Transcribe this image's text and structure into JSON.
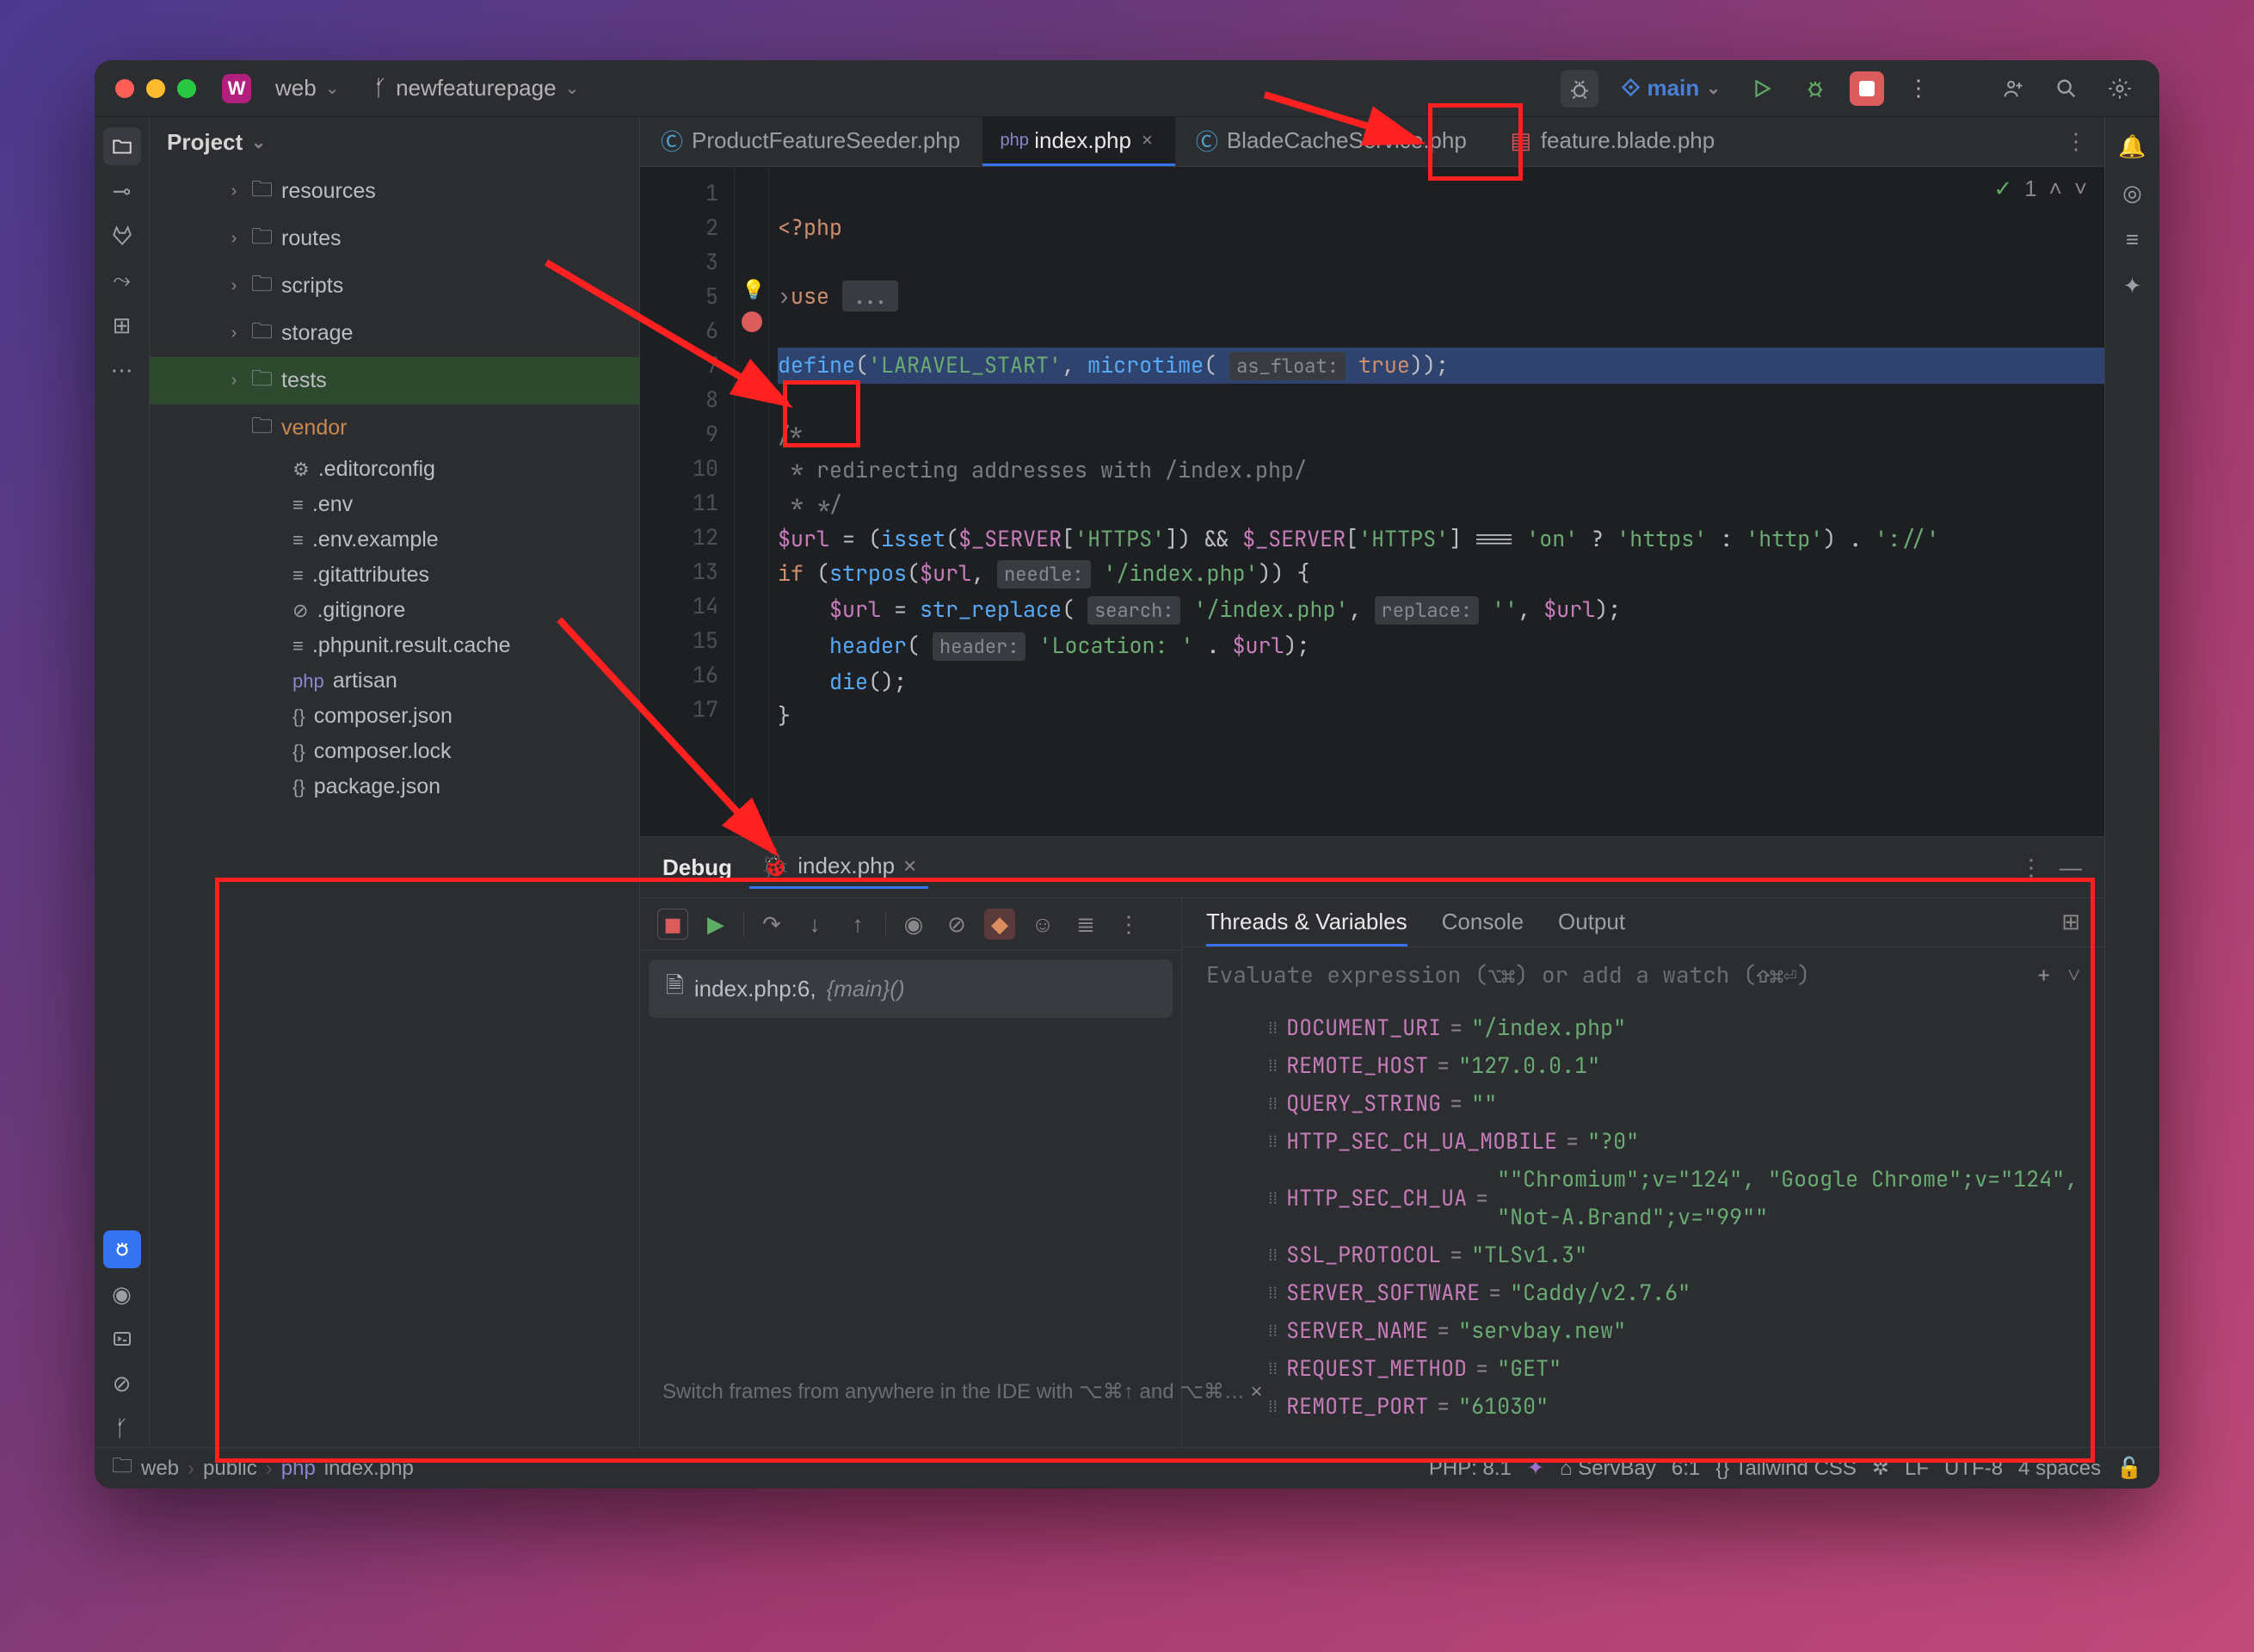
{
  "titlebar": {
    "project_badge": "W",
    "project_name": "web",
    "branch_icon": "branch",
    "branch_name": "newfeaturepage",
    "vcs_label": "main"
  },
  "toolbar_icons": [
    "debug-listen",
    "vcs",
    "main-dropdown",
    "run",
    "debug",
    "stop",
    "more",
    "add-user",
    "search",
    "settings"
  ],
  "sidebar": {
    "header": "Project",
    "tree": [
      {
        "label": "resources",
        "type": "folder",
        "depth": 1,
        "expandable": true
      },
      {
        "label": "routes",
        "type": "folder",
        "depth": 1,
        "expandable": true
      },
      {
        "label": "scripts",
        "type": "folder",
        "depth": 1,
        "expandable": true
      },
      {
        "label": "storage",
        "type": "folder",
        "depth": 1,
        "expandable": true
      },
      {
        "label": "tests",
        "type": "folder",
        "depth": 1,
        "expandable": true,
        "hl": true
      },
      {
        "label": "vendor",
        "type": "folder",
        "depth": 1,
        "expandable": false,
        "orange": true
      },
      {
        "label": ".editorconfig",
        "type": "gear",
        "depth": 2
      },
      {
        "label": ".env",
        "type": "file",
        "depth": 2
      },
      {
        "label": ".env.example",
        "type": "file",
        "depth": 2
      },
      {
        "label": ".gitattributes",
        "type": "file",
        "depth": 2
      },
      {
        "label": ".gitignore",
        "type": "ignore",
        "depth": 2
      },
      {
        "label": ".phpunit.result.cache",
        "type": "file",
        "depth": 2
      },
      {
        "label": "artisan",
        "type": "php",
        "depth": 2
      },
      {
        "label": "composer.json",
        "type": "json",
        "depth": 2
      },
      {
        "label": "composer.lock",
        "type": "json",
        "depth": 2
      },
      {
        "label": "package.json",
        "type": "json",
        "depth": 2
      }
    ]
  },
  "tabs": [
    {
      "label": "ProductFeatureSeeder.php",
      "icon": "php-cls",
      "color": "#4fa3d1"
    },
    {
      "label": "index.php",
      "icon": "php",
      "active": true
    },
    {
      "label": "BladeCacheService.php",
      "icon": "php-cls",
      "color": "#4fa3d1"
    },
    {
      "label": "feature.blade.php",
      "icon": "blade",
      "color": "#d15555"
    }
  ],
  "editor": {
    "lines": [
      "1",
      "2",
      "3",
      "5",
      "6",
      "7",
      "8",
      "9",
      "10",
      "11",
      "12",
      "13",
      "14",
      "15",
      "16",
      "17"
    ],
    "code": {
      "l1": "<?php",
      "l3_use": "use",
      "l3_fold": "...",
      "l6_define": "define",
      "l6_str": "'LARAVEL_START'",
      "l6_fn": "microtime",
      "l6_hint": "as_float:",
      "l6_true": "true",
      "l8": "/*",
      "l9": " * redirecting addresses with /index.php/",
      "l10": " * */",
      "l11_var": "$url",
      "l11_isset": "isset",
      "l11_srv": "$_SERVER",
      "l11_https": "'HTTPS'",
      "l11_on": "'on'",
      "l11_https2": "'https'",
      "l11_http": "'http'",
      "l11_sep": "'://'",
      "l12_if": "if",
      "l12_strpos": "strpos",
      "l12_hint": "needle:",
      "l12_idx": "'/index.php'",
      "l13_repl": "str_replace",
      "l13_h1": "search:",
      "l13_idx": "'/index.php'",
      "l13_h2": "replace:",
      "l13_empty": "''",
      "l14_hdr": "header",
      "l14_hint": "header:",
      "l14_loc": "'Location: '",
      "l15_die": "die"
    },
    "overlay": {
      "checks": "1"
    }
  },
  "debug": {
    "title": "Debug",
    "tab": "index.php",
    "frame": {
      "file": "index.php:6,",
      "fn": "{main}()"
    },
    "tabs2": [
      "Threads & Variables",
      "Console",
      "Output"
    ],
    "eval_placeholder": "Evaluate expression (⌥⌘) or add a watch (⇧⌘⏎)",
    "vars": [
      {
        "name": "DOCUMENT_URI",
        "val": "\"/index.php\""
      },
      {
        "name": "REMOTE_HOST",
        "val": "\"127.0.0.1\""
      },
      {
        "name": "QUERY_STRING",
        "val": "\"\""
      },
      {
        "name": "HTTP_SEC_CH_UA_MOBILE",
        "val": "\"?0\""
      },
      {
        "name": "HTTP_SEC_CH_UA",
        "val": "\"\"Chromium\";v=\"124\", \"Google Chrome\";v=\"124\", \"Not-A.Brand\";v=\"99\"\""
      },
      {
        "name": "SSL_PROTOCOL",
        "val": "\"TLSv1.3\""
      },
      {
        "name": "SERVER_SOFTWARE",
        "val": "\"Caddy/v2.7.6\""
      },
      {
        "name": "SERVER_NAME",
        "val": "\"servbay.new\""
      },
      {
        "name": "REQUEST_METHOD",
        "val": "\"GET\""
      },
      {
        "name": "REMOTE_PORT",
        "val": "\"61030\""
      }
    ],
    "tip": "Switch frames from anywhere in the IDE with ⌥⌘↑ and ⌥⌘…"
  },
  "statusbar": {
    "crumbs": [
      "web",
      "public",
      "index.php"
    ],
    "php": "PHP: 8.1",
    "srv": "ServBay",
    "pos": "6:1",
    "tw": "Tailwind CSS",
    "enc": "LF",
    "charset": "UTF-8",
    "indent": "4 spaces"
  }
}
